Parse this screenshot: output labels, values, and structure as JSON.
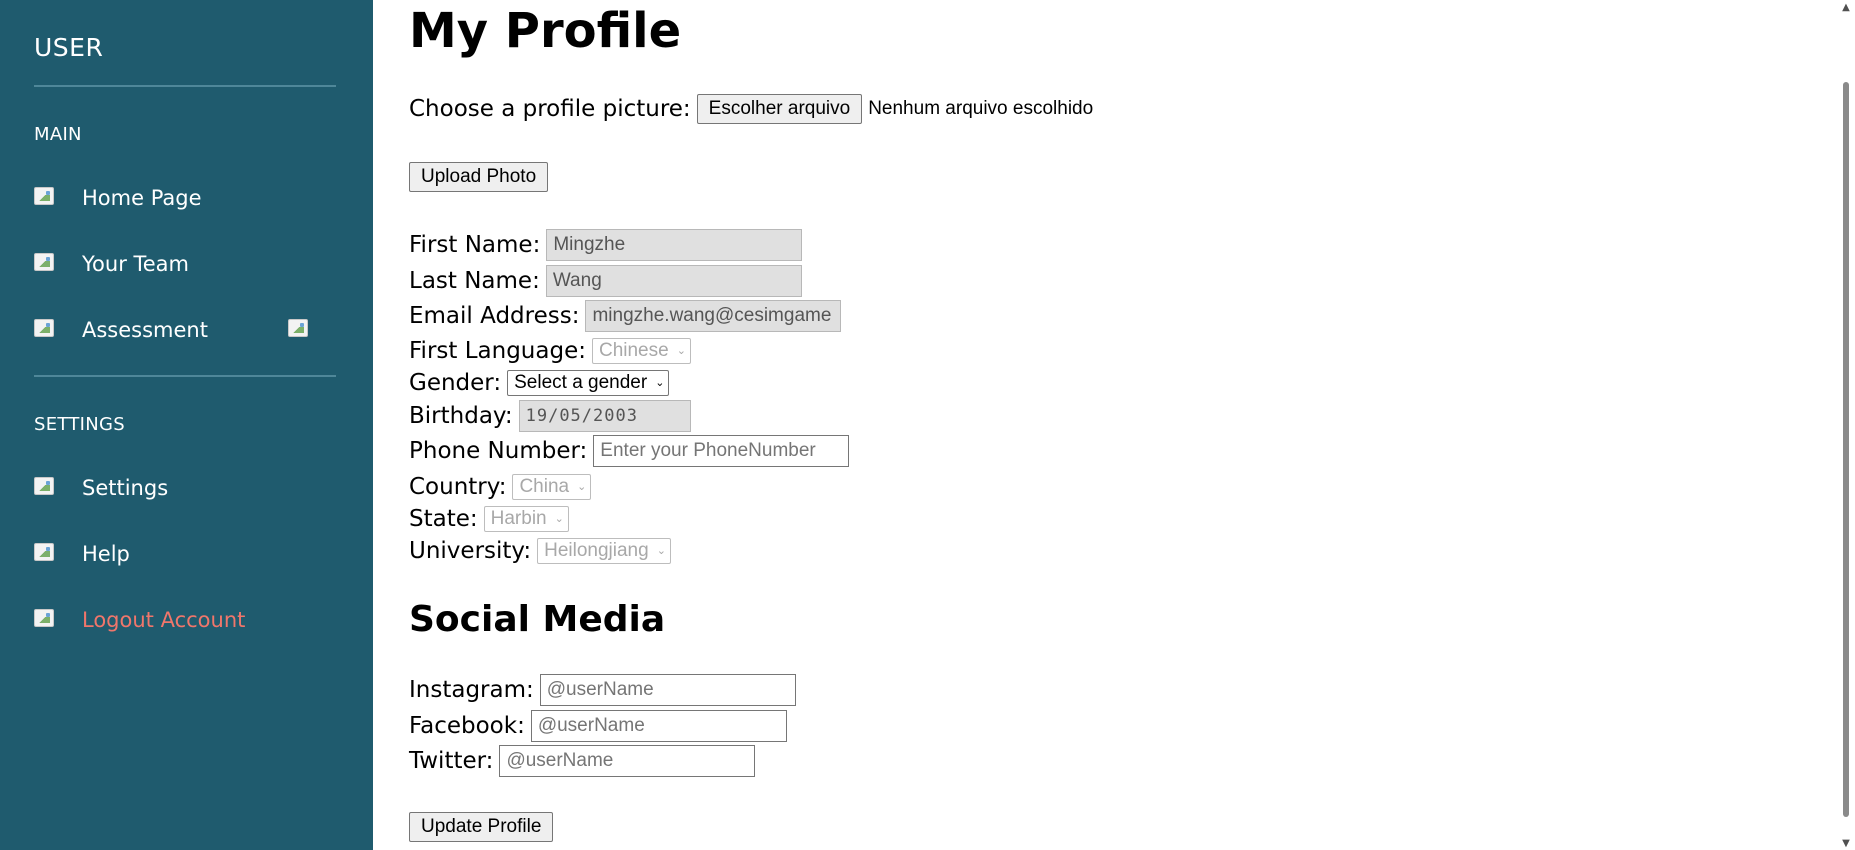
{
  "sidebar": {
    "title": "USER",
    "sections": [
      {
        "heading": "MAIN",
        "items": [
          {
            "label": "Home Page",
            "icon": "home-icon"
          },
          {
            "label": "Your Team",
            "icon": "team-icon"
          },
          {
            "label": "Assessment",
            "icon": "assessment-icon",
            "badge_icon": "notification-icon"
          }
        ]
      },
      {
        "heading": "SETTINGS",
        "items": [
          {
            "label": "Settings",
            "icon": "settings-icon"
          },
          {
            "label": "Help",
            "icon": "help-icon"
          },
          {
            "label": "Logout Account",
            "icon": "logout-icon",
            "color": "#f0766b"
          }
        ]
      }
    ],
    "background": "#1f5b6e"
  },
  "main": {
    "title": "My Profile",
    "profile_picture": {
      "label": "Choose a profile picture:",
      "button_label": "Escolher arquivo",
      "status": "Nenhum arquivo escolhido"
    },
    "upload_button": "Upload Photo",
    "fields": {
      "first_name": {
        "label": "First Name:",
        "value": "Mingzhe"
      },
      "last_name": {
        "label": "Last Name:",
        "value": "Wang"
      },
      "email": {
        "label": "Email Address:",
        "value": "mingzhe.wang@cesimgame"
      },
      "first_language": {
        "label": "First Language:",
        "value": "Chinese"
      },
      "gender": {
        "label": "Gender:",
        "value": "Select a gender"
      },
      "birthday": {
        "label": "Birthday:",
        "value": "19/05/2003"
      },
      "phone": {
        "label": "Phone Number:",
        "placeholder": "Enter your PhoneNumber"
      },
      "country": {
        "label": "Country:",
        "value": "China"
      },
      "state": {
        "label": "State:",
        "value": "Harbin"
      },
      "university": {
        "label": "University:",
        "value": "Heilongjiang"
      }
    },
    "social_media": {
      "title": "Social Media",
      "instagram": {
        "label": "Instagram:",
        "placeholder": "@userName"
      },
      "facebook": {
        "label": "Facebook:",
        "placeholder": "@userName"
      },
      "twitter": {
        "label": "Twitter:",
        "placeholder": "@userName"
      }
    },
    "update_button": "Update Profile"
  }
}
